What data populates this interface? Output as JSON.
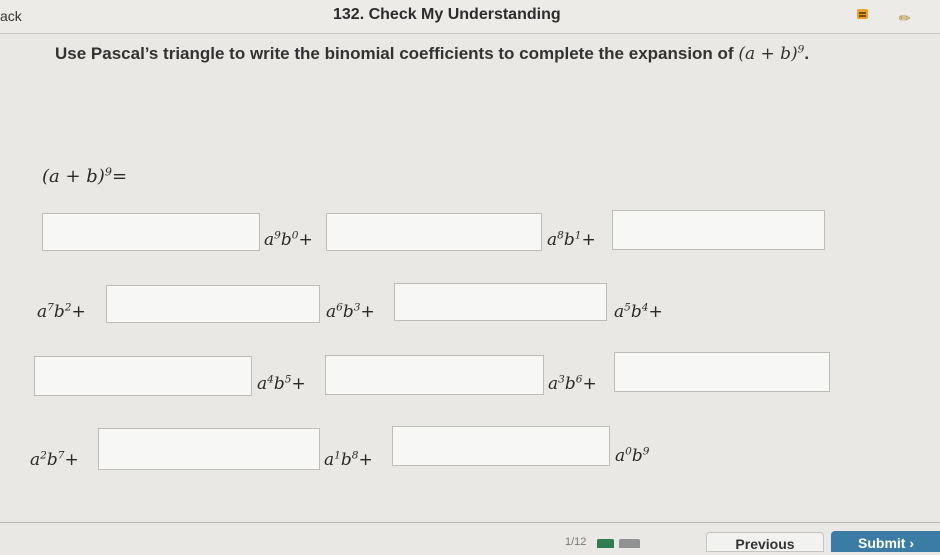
{
  "header": {
    "back_label": "ack",
    "title": "132. Check My Understanding",
    "note_icon": "note-icon",
    "pencil_icon": "pencil-icon"
  },
  "question": {
    "prompt_text": "Use Pascal’s triangle to write the binomial coefficients to complete the expansion of",
    "prompt_expr_base": "(a + b)",
    "prompt_expr_exp": "9",
    "prompt_end": ".",
    "lhs_base": "(a + b)",
    "lhs_exp": "9",
    "lhs_eq": "="
  },
  "terms": [
    {
      "a": "a",
      "ae": "9",
      "b": "b",
      "be": "0",
      "op": "+"
    },
    {
      "a": "a",
      "ae": "8",
      "b": "b",
      "be": "1",
      "op": "+"
    },
    {
      "a": "a",
      "ae": "7",
      "b": "b",
      "be": "2",
      "op": "+"
    },
    {
      "a": "a",
      "ae": "6",
      "b": "b",
      "be": "3",
      "op": "+"
    },
    {
      "a": "a",
      "ae": "5",
      "b": "b",
      "be": "4",
      "op": "+"
    },
    {
      "a": "a",
      "ae": "4",
      "b": "b",
      "be": "5",
      "op": "+"
    },
    {
      "a": "a",
      "ae": "3",
      "b": "b",
      "be": "6",
      "op": "+"
    },
    {
      "a": "a",
      "ae": "2",
      "b": "b",
      "be": "7",
      "op": "+"
    },
    {
      "a": "a",
      "ae": "1",
      "b": "b",
      "be": "8",
      "op": "+"
    },
    {
      "a": "a",
      "ae": "0",
      "b": "b",
      "be": "9",
      "op": ""
    }
  ],
  "coefficient_inputs": [
    "",
    "",
    "",
    "",
    "",
    "",
    "",
    "",
    "",
    ""
  ],
  "footer": {
    "page_indicator": "1/12",
    "previous_label": "Previous",
    "submit_label": "Submit  ›"
  },
  "colors": {
    "submit": "#3a7ca3",
    "progress_current": "#2f7d4e",
    "note_icon": "#e6a12a"
  }
}
